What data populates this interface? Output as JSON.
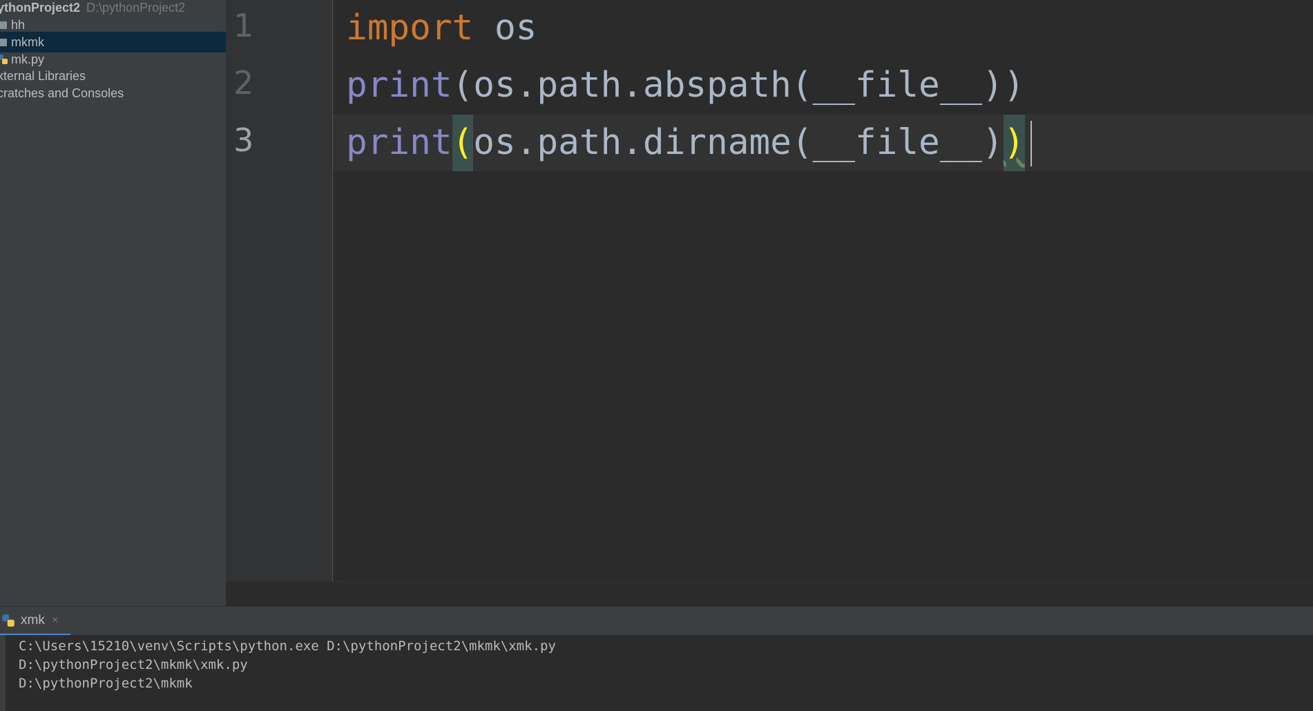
{
  "project": {
    "root_name": "ythonProject2",
    "root_path": "D:\\pythonProject2",
    "items": [
      {
        "label": "hh",
        "icon": "folder-icon"
      },
      {
        "label": "mkmk",
        "icon": "folder-icon",
        "selected": true
      },
      {
        "label": "mk.py",
        "icon": "python-file-icon"
      },
      {
        "label": "xternal Libraries"
      },
      {
        "label": "cratches and Consoles"
      }
    ]
  },
  "editor": {
    "line_numbers": [
      "1",
      "2",
      "3"
    ],
    "current_line": "3",
    "lines": [
      {
        "kw": "import",
        "rest": " os"
      },
      {
        "fn": "print",
        "args": "(os.path.abspath(__file__))"
      },
      {
        "fn": "print",
        "open": "(",
        "mid": "os.path.dirname(__file__)",
        "close": ")"
      }
    ]
  },
  "run": {
    "tab_label": "xmk",
    "tab_close": "×",
    "output": [
      "C:\\Users\\15210\\venv\\Scripts\\python.exe D:\\pythonProject2\\mkmk\\xmk.py",
      "D:\\pythonProject2\\mkmk\\xmk.py",
      "D:\\pythonProject2\\mkmk"
    ]
  },
  "colors": {
    "keyword": "#cc7832",
    "builtin": "#8888c6",
    "text": "#a9b7c6",
    "brace_match": "#ffef28",
    "selection": "#0d293e",
    "background": "#2b2b2b",
    "panel": "#3c3f41"
  }
}
